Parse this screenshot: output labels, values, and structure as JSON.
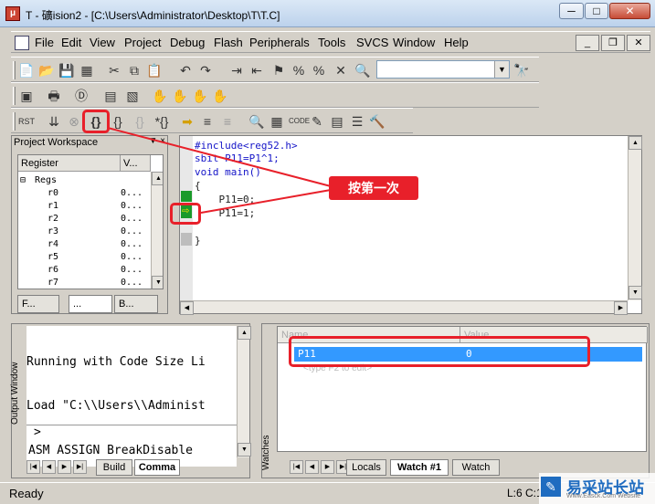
{
  "window": {
    "title": "T  - 礦ision2 - [C:\\Users\\Administrator\\Desktop\\T\\T.C]",
    "min_glyph": "─",
    "max_glyph": "□",
    "close_glyph": "✕"
  },
  "menubar": {
    "items": [
      "File",
      "Edit",
      "View",
      "Project",
      "Debug",
      "Flash",
      "Peripherals",
      "Tools",
      "SVCS",
      "Window",
      "Help"
    ],
    "mdi": {
      "min": "_",
      "restore": "❐",
      "close": "✕"
    }
  },
  "toolbar": {
    "icons_row1": [
      "new-file-icon",
      "open-icon",
      "save-icon",
      "save-all-icon",
      "cut-icon",
      "copy-icon",
      "paste-icon",
      "undo-icon",
      "redo-icon",
      "indent-icon",
      "outdent-icon",
      "bookmark-icon",
      "bookmark-prev-icon",
      "bookmark-next-icon",
      "clear-bookmark-icon",
      "find-icon",
      "binoculars-icon"
    ],
    "combo_value": "",
    "combo_arrow": "▼",
    "icons_row3": [
      "reset-icon",
      "run-icon",
      "stop-icon",
      "step-into-icon",
      "step-over-icon",
      "step-out-icon",
      "run-to-cursor-icon"
    ]
  },
  "workspace": {
    "title": "Project Workspace",
    "close": "▼ ×",
    "col_register": "Register",
    "col_value": "V...",
    "group": "Regs",
    "registers": [
      {
        "name": "r0",
        "value": "0..."
      },
      {
        "name": "r1",
        "value": "0..."
      },
      {
        "name": "r2",
        "value": "0..."
      },
      {
        "name": "r3",
        "value": "0..."
      },
      {
        "name": "r4",
        "value": "0..."
      },
      {
        "name": "r5",
        "value": "0..."
      },
      {
        "name": "r6",
        "value": "0..."
      },
      {
        "name": "r7",
        "value": "0..."
      }
    ],
    "tabs": [
      "F...",
      "...",
      "B..."
    ]
  },
  "editor": {
    "lines": [
      "#include<reg52.h>",
      "sbit P11=P1^1;",
      "void main()",
      "{",
      "    P11=0;",
      "    P11=1;",
      "",
      "}"
    ]
  },
  "annotation": {
    "callout": "按第一次"
  },
  "output": {
    "side_label": "Output Window",
    "lines": [
      "Running with Code Size Li",
      "Load \"C:\\\\Users\\\\Administ"
    ],
    "prompt": ">",
    "command": "ASM ASSIGN BreakDisable",
    "tabs": [
      "Build",
      "Comma"
    ]
  },
  "watch": {
    "side_label": "Watches",
    "col_name": "Name",
    "col_value": "Value",
    "selected_name": "P11",
    "selected_value": "0",
    "hint": "<type F2 to edit>",
    "tabs": [
      "Locals",
      "Watch #1",
      "Watch"
    ]
  },
  "status": {
    "text": "Ready",
    "position": "L:6 C:1"
  },
  "watermark": {
    "logo": "✎",
    "text": "易采站长站",
    "sub": "Www.Easck.Com  Website"
  }
}
